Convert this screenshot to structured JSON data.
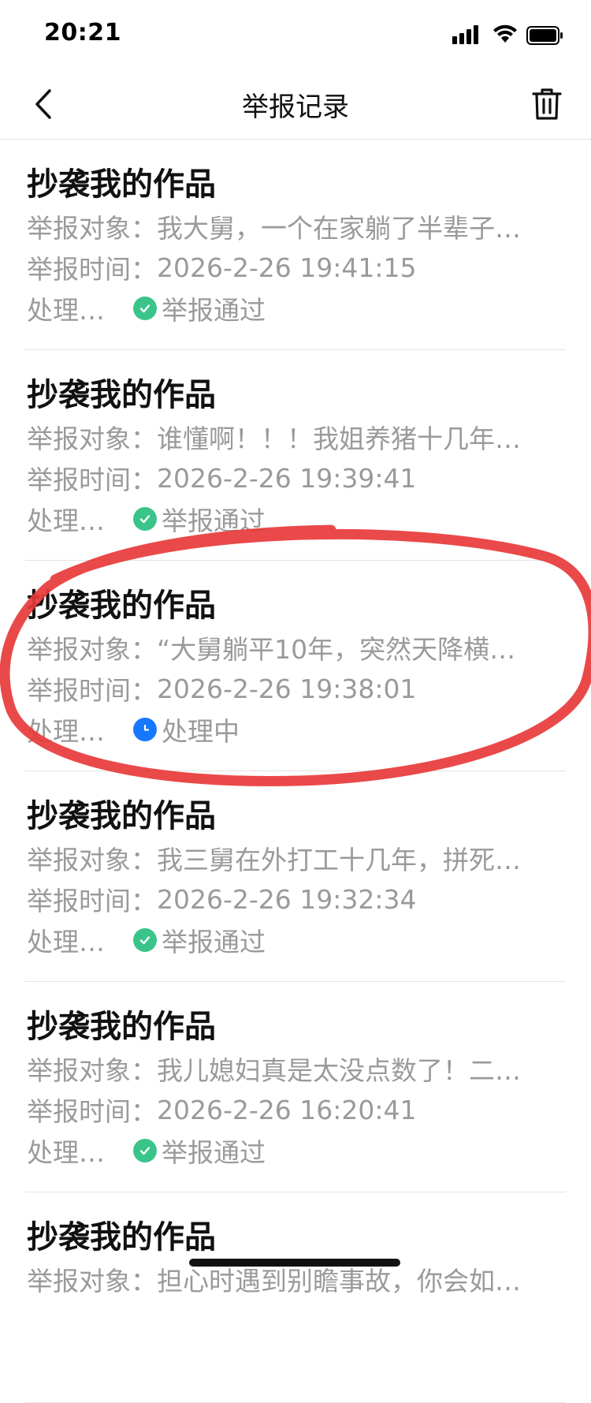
{
  "status_bar": {
    "time": "20:21",
    "icons": [
      "signal-icon",
      "wifi-icon",
      "battery-icon"
    ]
  },
  "nav": {
    "title": "举报记录",
    "back_icon": "chevron-left-icon",
    "delete_icon": "trash-icon"
  },
  "records": [
    {
      "title": "抄袭我的作品",
      "target_label": "举报对象：",
      "target_value": "我大舅，一个在家躺了半辈子…",
      "time_label": "举报时间：",
      "time_value": "2026-2-26 19:41:15",
      "status_label": "处理…",
      "status_text": "举报通过",
      "status_icon": "check-circle-icon",
      "status_color": "#3ac48a"
    },
    {
      "title": "抄袭我的作品",
      "target_label": "举报对象：",
      "target_value": "谁懂啊！！！我姐养猪十几年…",
      "time_label": "举报时间：",
      "time_value": "2026-2-26 19:39:41",
      "status_label": "处理…",
      "status_text": "举报通过",
      "status_icon": "check-circle-icon",
      "status_color": "#3ac48a"
    },
    {
      "title": "抄袭我的作品",
      "target_label": "举报对象：",
      "target_value": "“大舅躺平10年，突然天降横…",
      "time_label": "举报时间：",
      "time_value": "2026-2-26 19:38:01",
      "status_label": "处理…",
      "status_text": "处理中",
      "status_icon": "clock-icon",
      "status_color": "#1677ff"
    },
    {
      "title": "抄袭我的作品",
      "target_label": "举报对象：",
      "target_value": "我三舅在外打工十几年，拼死…",
      "time_label": "举报时间：",
      "time_value": "2026-2-26 19:32:34",
      "status_label": "处理…",
      "status_text": "举报通过",
      "status_icon": "check-circle-icon",
      "status_color": "#3ac48a"
    },
    {
      "title": "抄袭我的作品",
      "target_label": "举报对象：",
      "target_value": "我儿媳妇真是太没点数了！二…",
      "time_label": "举报时间：",
      "time_value": "2026-2-26 16:20:41",
      "status_label": "处理…",
      "status_text": "举报通过",
      "status_icon": "check-circle-icon",
      "status_color": "#3ac48a"
    },
    {
      "title": "抄袭我的作品",
      "target_label": "举报对象：",
      "target_value": "担心时遇到别瞻事故，你会如…",
      "time_label": "",
      "time_value": "",
      "status_label": "",
      "status_text": "",
      "status_icon": "",
      "status_color": "#3ac48a"
    }
  ],
  "colors": {
    "annotation": "#e83a3a",
    "approved": "#3ac48a",
    "processing": "#1677ff",
    "secondary_text": "#9a9a9a"
  }
}
